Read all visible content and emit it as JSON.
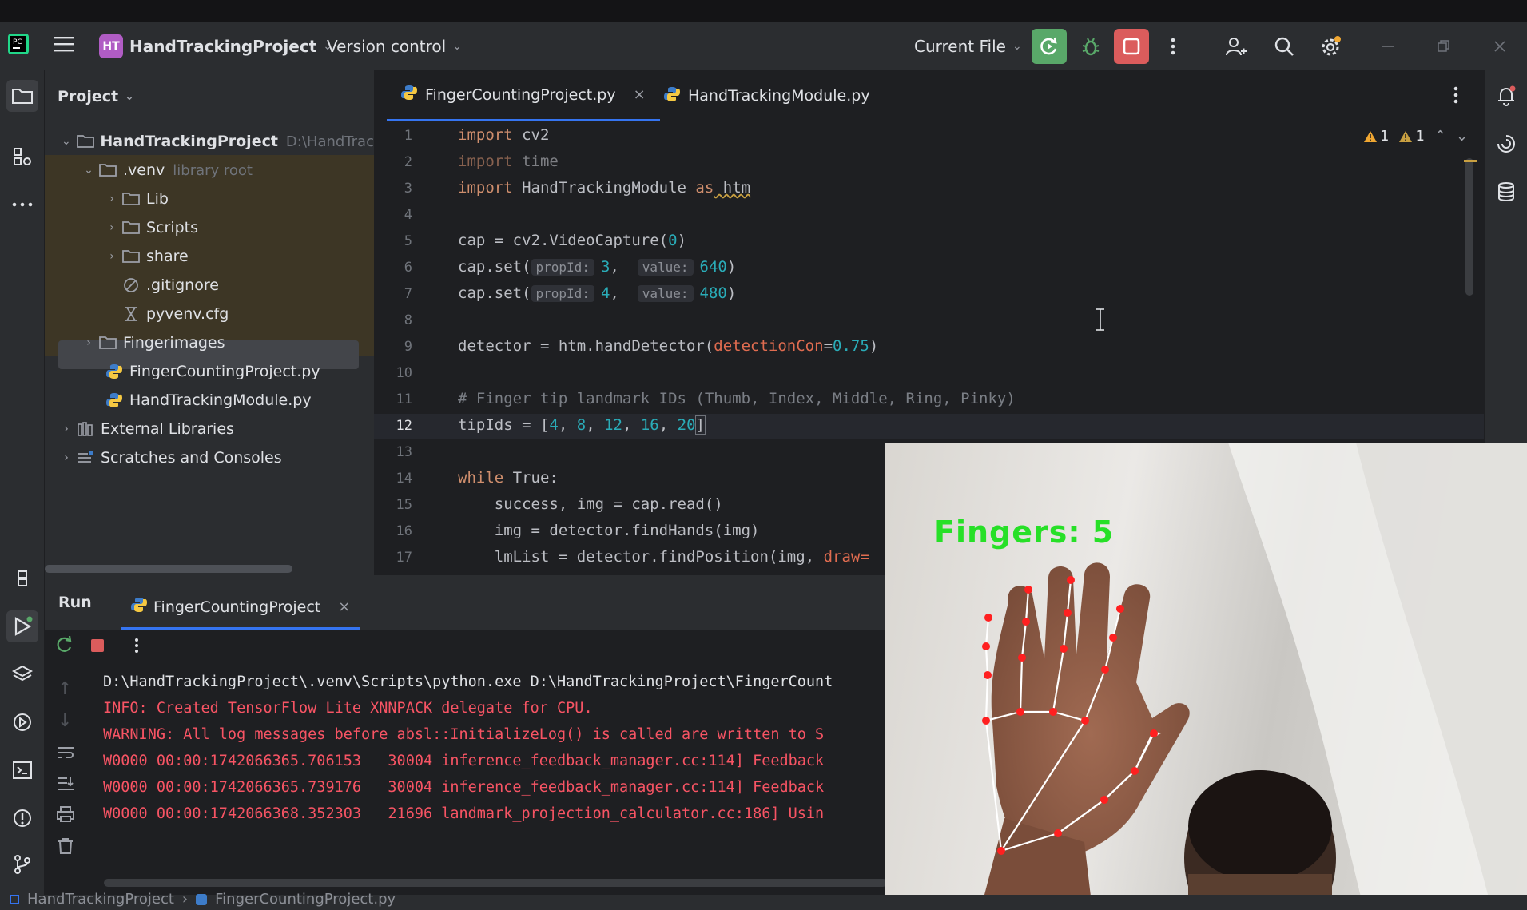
{
  "titlebar": {
    "project_badge": "HT",
    "project_name": "HandTrackingProject",
    "version_control": "Version control",
    "run_config": "Current File"
  },
  "project_panel": {
    "title": "Project",
    "tree": [
      {
        "label": "HandTrackingProject",
        "hint": "D:\\HandTrac",
        "type": "folder",
        "expanded": true
      },
      {
        "label": ".venv",
        "hint": "library root",
        "type": "folder",
        "expanded": true
      },
      {
        "label": "Lib",
        "type": "folder"
      },
      {
        "label": "Scripts",
        "type": "folder"
      },
      {
        "label": "share",
        "type": "folder"
      },
      {
        "label": ".gitignore",
        "type": "ignore"
      },
      {
        "label": "pyvenv.cfg",
        "type": "cfg"
      },
      {
        "label": "Fingerimages",
        "type": "folder"
      },
      {
        "label": "FingerCountingProject.py",
        "type": "python",
        "selected": true
      },
      {
        "label": "HandTrackingModule.py",
        "type": "python"
      },
      {
        "label": "External Libraries",
        "type": "library"
      },
      {
        "label": "Scratches and Consoles",
        "type": "scratch"
      }
    ]
  },
  "editor": {
    "tabs": [
      {
        "label": "FingerCountingProject.py",
        "active": true
      },
      {
        "label": "HandTrackingModule.py",
        "active": false
      }
    ],
    "warnings_a": "1",
    "warnings_b": "1",
    "line_numbers": [
      "1",
      "2",
      "3",
      "4",
      "5",
      "6",
      "7",
      "8",
      "9",
      "10",
      "11",
      "12",
      "13",
      "14",
      "15",
      "16",
      "17"
    ],
    "current_line": "12",
    "code": {
      "l1_kw": "import",
      "l1_rest": " cv2",
      "l2_kw": "import",
      "l2_rest": " time",
      "l3_kw": "import",
      "l3_mod": " HandTrackingModule ",
      "l3_as": "as",
      "l3_alias": " htm",
      "l5_a": "cap = cv2.VideoCapture(",
      "l5_n": "0",
      "l5_b": ")",
      "l6_a": "cap.set(",
      "l6_h1": "propId:",
      "l6_n1": "3",
      "l6_c": ",  ",
      "l6_h2": "value:",
      "l6_n2": "640",
      "l6_b": ")",
      "l7_a": "cap.set(",
      "l7_h1": "propId:",
      "l7_n1": "4",
      "l7_c": ",  ",
      "l7_h2": "value:",
      "l7_n2": "480",
      "l7_b": ")",
      "l9_a": "detector = htm.handDetector(",
      "l9_p": "detectionCon",
      "l9_eq": "=",
      "l9_n": "0.75",
      "l9_b": ")",
      "l11": "# Finger tip landmark IDs (Thumb, Index, Middle, Ring, Pinky)",
      "l12_a": "tipIds = [",
      "l12_n1": "4",
      "l12_n2": "8",
      "l12_n3": "12",
      "l12_n4": "16",
      "l12_n5": "20",
      "l12_b": "]",
      "l14_kw": "while",
      "l14_rest": " True:",
      "l15": "    success, img = cap.read()",
      "l16": "    img = detector.findHands(img)",
      "l17_a": "    lmList = detector.findPosition(img, ",
      "l17_p": "draw="
    }
  },
  "run_panel": {
    "title": "Run",
    "tab_label": "FingerCountingProject",
    "console": [
      "D:\\HandTrackingProject\\.venv\\Scripts\\python.exe D:\\HandTrackingProject\\FingerCount",
      "INFO: Created TensorFlow Lite XNNPACK delegate for CPU.",
      "WARNING: All log messages before absl::InitializeLog() is called are written to S",
      "W0000 00:00:1742066365.706153   30004 inference_feedback_manager.cc:114] Feedback",
      "W0000 00:00:1742066365.739176   30004 inference_feedback_manager.cc:114] Feedback",
      "W0000 00:00:1742066368.352303   21696 landmark_projection_calculator.cc:186] Usin"
    ]
  },
  "webcam": {
    "label": "Fingers: 5"
  },
  "statusbar": {
    "crumb1": "HandTrackingProject",
    "crumb2": "FingerCountingProject.py"
  },
  "colors": {
    "accent": "#3574f0",
    "run_green": "#59a869",
    "stop_red": "#db5c5c",
    "error_text": "#f75464"
  }
}
